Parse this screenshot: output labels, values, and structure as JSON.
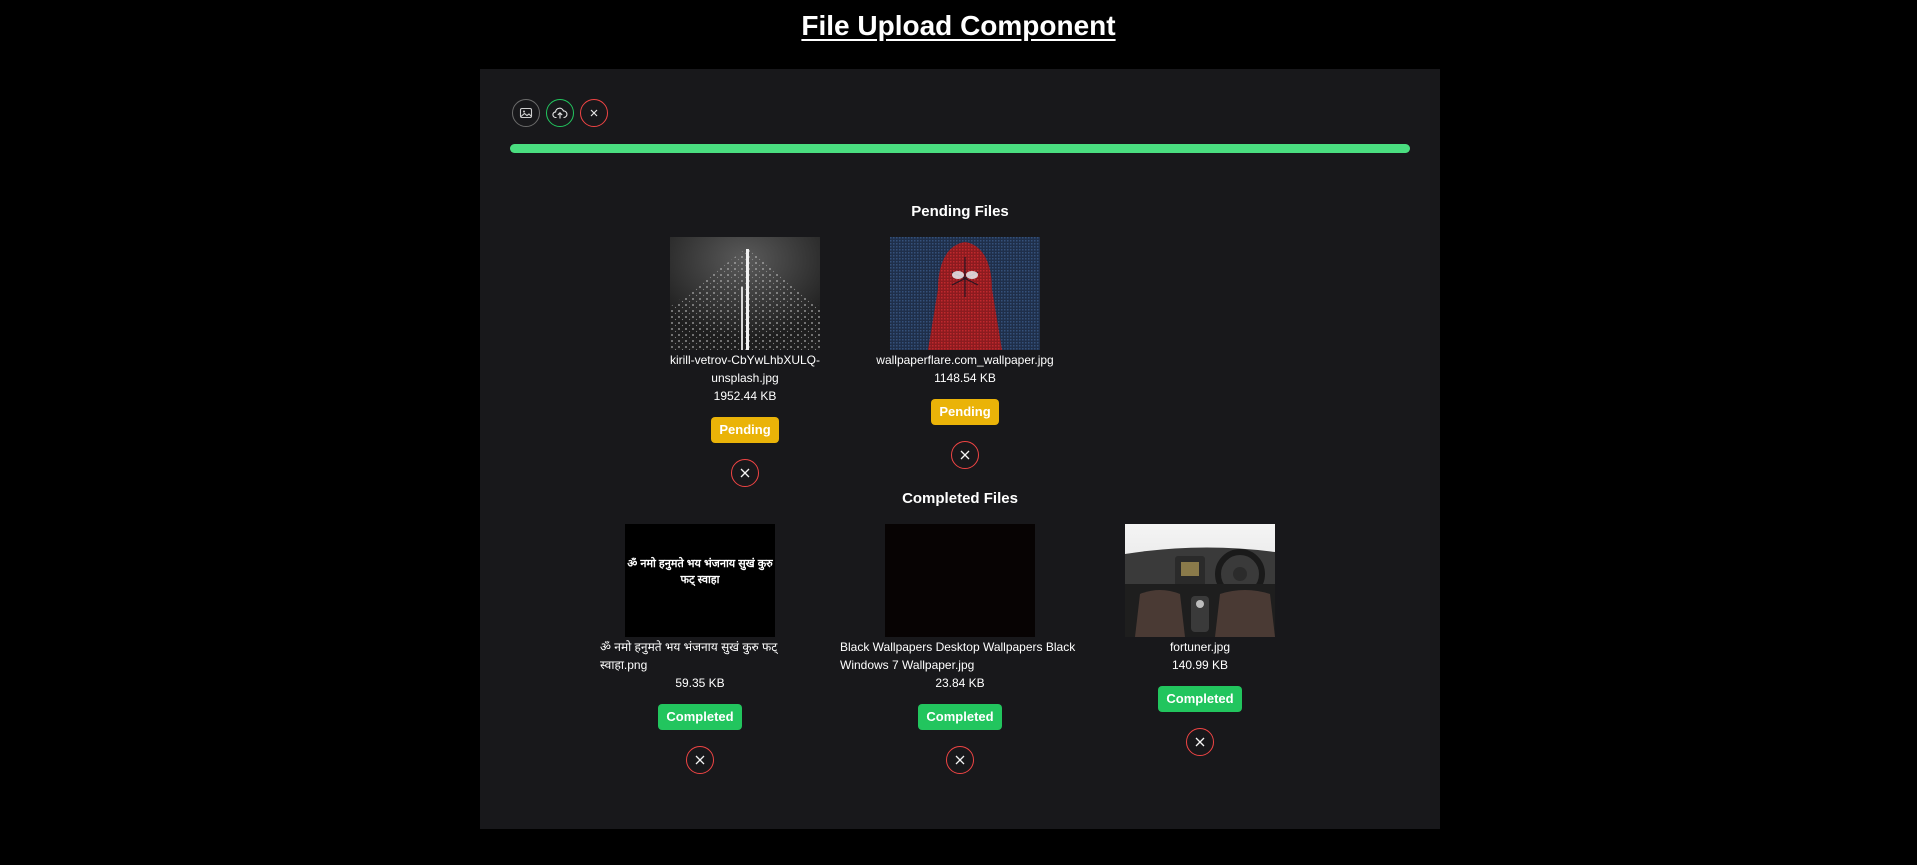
{
  "page": {
    "title": "File Upload Component"
  },
  "toolbar": {
    "select_icon": "image-icon",
    "upload_icon": "cloud-upload-icon",
    "cancel_icon": "close-icon"
  },
  "progress": {
    "value_percent": 100,
    "color": "#4ade80"
  },
  "pending": {
    "title": "Pending Files",
    "files": [
      {
        "name": "kirill-vetrov-CbYwLhbXULQ-unsplash.jpg",
        "size": "1952.44 KB",
        "status": "Pending"
      },
      {
        "name": "wallpaperflare.com_wallpaper.jpg",
        "size": "1148.54 KB",
        "status": "Pending"
      }
    ]
  },
  "completed": {
    "title": "Completed Files",
    "files": [
      {
        "name": "ॐ नमो हनुमते भय भंजनाय सुखं कुरु फट् स्वाहा.png",
        "size": "59.35 KB",
        "status": "Completed",
        "thumb_text": "ॐ नमो हनुमते भय भंजनाय सुखं कुरु फट् स्वाहा"
      },
      {
        "name": "Black Wallpapers Desktop Wallpapers Black Windows 7 Wallpaper.jpg",
        "size": "23.84 KB",
        "status": "Completed"
      },
      {
        "name": "fortuner.jpg",
        "size": "140.99 KB",
        "status": "Completed"
      }
    ]
  },
  "colors": {
    "pending": "#eab308",
    "completed": "#22c55e",
    "remove": "#ef4444",
    "panel": "#18181b"
  }
}
